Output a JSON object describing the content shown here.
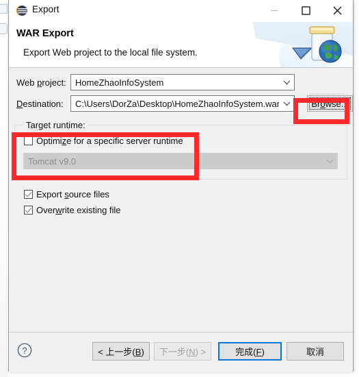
{
  "window": {
    "title": "Export",
    "app_icon": "eclipse-icon",
    "controls": {
      "minimize": "minimize-icon",
      "maximize": "maximize-icon",
      "close": "close-icon"
    }
  },
  "banner": {
    "title": "WAR Export",
    "description": "Export Web project to the local file system.",
    "art_icon": "war-jar-globe-icon"
  },
  "form": {
    "web_project": {
      "label": "Web ",
      "label_accel": "p",
      "label_rest": "roject:",
      "value": "HomeZhaoInfoSystem"
    },
    "destination": {
      "label": "",
      "label_accel": "D",
      "label_rest": "estination:",
      "value": "C:\\Users\\DorZa\\Desktop\\HomeZhaoInfoSystem.war"
    },
    "browse_button": "Br",
    "browse_accel": "o",
    "browse_rest": "wse..."
  },
  "target_runtime": {
    "legend": "Target runtime:",
    "optimize_checkbox": {
      "label_pre": "Optimi",
      "label_accel": "z",
      "label_post": "e for a specific server runtime",
      "checked": false
    },
    "runtime_combo": {
      "value": "Tomcat v9.0",
      "enabled": false
    }
  },
  "options": [
    {
      "label_pre": "Export ",
      "label_accel": "s",
      "label_post": "ource files",
      "checked": true
    },
    {
      "label_pre": "Over",
      "label_accel": "w",
      "label_post": "rite existing file",
      "checked": true
    }
  ],
  "footer": {
    "help": "help-icon",
    "back_button": "< 上一步(B)",
    "back_pre": "< 上一步(",
    "back_accel": "B",
    "back_post": ")",
    "next_button": "下一步(N) >",
    "next_pre": "下一步(",
    "next_accel": "N",
    "next_post": ") >",
    "finish_pre": "完成(",
    "finish_accel": "F",
    "finish_post": ")",
    "cancel_button": "取消"
  },
  "colors": {
    "accent": "#0078d7",
    "annotation_red": "#fc2b2b",
    "dialog_bg": "#f0f0f0",
    "disabled_bg": "#cccccc"
  }
}
